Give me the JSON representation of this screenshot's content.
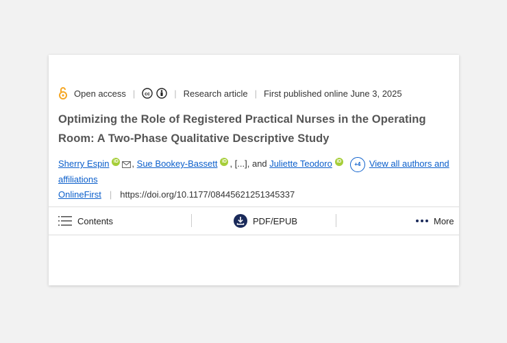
{
  "meta": {
    "access": "Open access",
    "type": "Research article",
    "published": "First published online June 3, 2025",
    "separator": "|",
    "cc_icon": "creative-commons-icon",
    "by_icon": "attribution-icon"
  },
  "title": "Optimizing the Role of Registered Practical Nurses in the Operating Room: A Two-Phase Qualitative Descriptive Study",
  "authors": {
    "a1": "Sherry Espin",
    "a2": "Sue Bookey-Bassett",
    "ellipsis": ", [...], and ",
    "a3": "Juliette Teodoro",
    "more_count": "+4",
    "view_all": "View all authors and affiliations",
    "orcid_label": "iD"
  },
  "doi_row": {
    "status": "OnlineFirst",
    "separator": "|",
    "doi": "https://doi.org/10.1177/08445621251345337"
  },
  "toolbar": {
    "contents": "Contents",
    "pdf": "PDF/EPUB",
    "more": "More"
  },
  "colors": {
    "link": "#0a5ecb",
    "open_access": "#f5a623",
    "orcid": "#a6ce39",
    "pdf_icon": "#1a2a5a"
  }
}
